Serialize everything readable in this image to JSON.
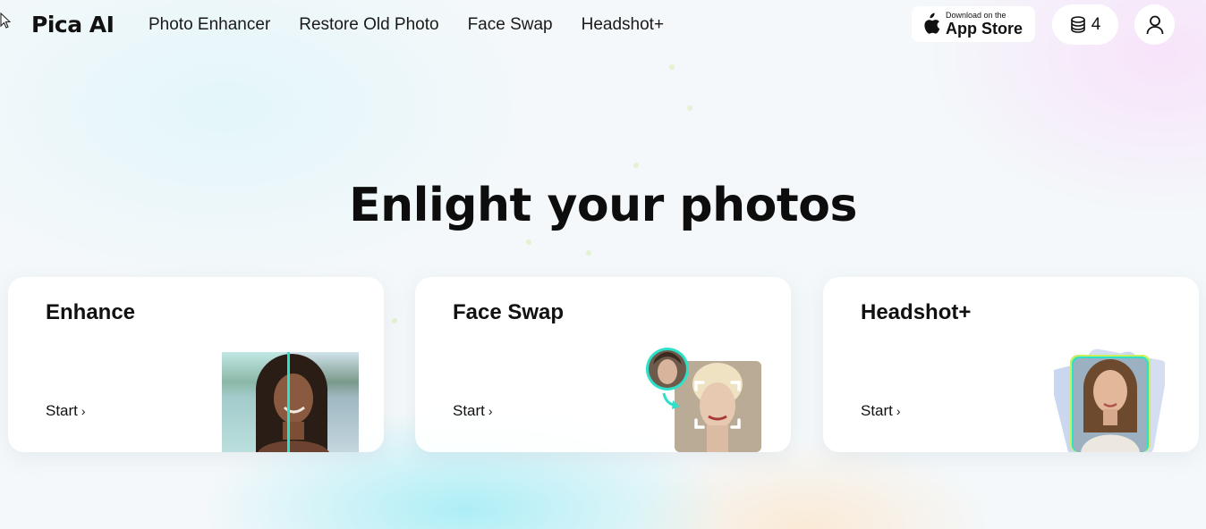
{
  "brand": {
    "name": "Pica AI"
  },
  "nav": {
    "items": [
      {
        "label": "Photo Enhancer"
      },
      {
        "label": "Restore Old Photo"
      },
      {
        "label": "Face Swap"
      },
      {
        "label": "Headshot+"
      }
    ]
  },
  "appstore": {
    "small": "Download on the",
    "big": "App Store"
  },
  "credits": {
    "count": "4",
    "icon": "coins-stack-icon"
  },
  "account": {
    "icon": "user-icon"
  },
  "hero": {
    "title": "Enlight your photos"
  },
  "cards": [
    {
      "title": "Enhance",
      "cta": "Start"
    },
    {
      "title": "Face Swap",
      "cta": "Start"
    },
    {
      "title": "Headshot+",
      "cta": "Start"
    }
  ],
  "colors": {
    "accent_teal": "#2fe0c8",
    "accent_lime": "#c8f060",
    "text": "#111111"
  }
}
